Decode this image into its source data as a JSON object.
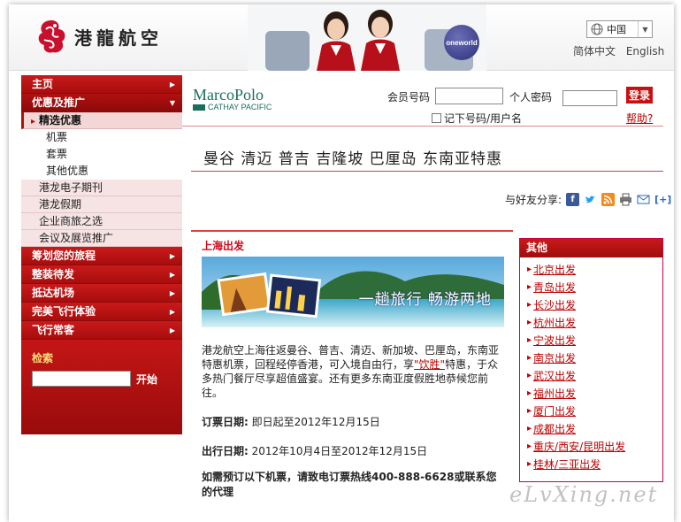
{
  "header": {
    "logo_text": "港龍航空",
    "alliance_logo": "oneworld",
    "region_value": "中国",
    "lang_simplified": "简体中文",
    "lang_english": "English"
  },
  "nav": {
    "home": "主页",
    "offers": "优惠及推广",
    "selected_offers": "精选优惠",
    "leaf_tickets": "机票",
    "leaf_packages": "套票",
    "leaf_other": "其他优惠",
    "sub_newsletter": "港龙电子期刊",
    "sub_holidays": "港龙假期",
    "sub_corporate": "企业商旅之选",
    "sub_conference": "会议及展览推广",
    "plan_trip": "筹划您的旅程",
    "checkin": "整装待发",
    "arrive": "抵达机场",
    "experience": "完美飞行体验",
    "frequent_flyer": "飞行常客"
  },
  "search": {
    "title": "检索",
    "button": "开始"
  },
  "member": {
    "brand_name": "MarcoPolo",
    "brand_sub": "CATHAY PACIFIC",
    "id_label": "会员号码",
    "pin_label": "个人密码",
    "login_button": "登录",
    "remember_label": "记下号码/用户名",
    "help_link": "帮助?"
  },
  "page": {
    "title": "曼谷 清迈 普吉 吉隆坡 巴厘岛 东南亚特惠",
    "share_label": "与好友分享:",
    "share_more": "[+]"
  },
  "promo": {
    "section_heading": "上海出发",
    "banner_slogan": "一趟旅行 畅游两地",
    "body_pre": "港龙航空上海往返曼谷、普吉、清迈、新加坡、巴厘岛，东南亚特惠机票，回程经停香港，可入境自由行，享",
    "body_link": "\"饮胜\"",
    "body_post": "特惠，于众多热门餐厅尽享超值盛宴。还有更多东南亚度假胜地恭候您前往。",
    "booking_label": "订票日期:",
    "booking_value": "即日起至2012年12月15日",
    "travel_label": "出行日期:",
    "travel_value": "2012年10月4日至2012年12月15日",
    "note": "如需预订以下机票，请致电订票热线400-888-6628或联系您的代理"
  },
  "sidebar": {
    "title": "其他",
    "items": [
      "北京出发",
      "青岛出发",
      "长沙出发",
      "杭州出发",
      "宁波出发",
      "南京出发",
      "武汉出发",
      "福州出发",
      "厦门出发",
      "成都出发",
      "重庆/西安/昆明出发",
      "桂林/三亚出发"
    ]
  },
  "watermark": "eLvXing.net",
  "colors": {
    "brand_red": "#c81a1a",
    "heading_red": "#d2081a",
    "marcopolo_green": "#1b6d5e"
  }
}
